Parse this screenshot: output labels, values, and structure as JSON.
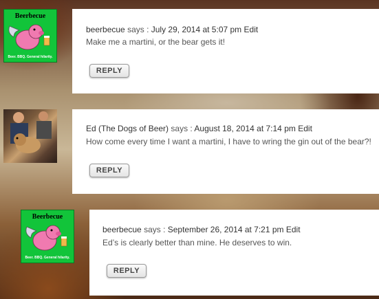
{
  "comments": [
    {
      "author": "beerbecue",
      "says": "says :",
      "date": "July 29, 2014 at 5:07 pm",
      "edit": "Edit",
      "text": "Make me a martini, or the bear gets it!",
      "reply": "REPLY",
      "avatar": {
        "type": "pig-logo",
        "title": "Beerbecue",
        "tagline": "Beer. BBQ. General hilarity."
      }
    },
    {
      "author": "Ed (The Dogs of Beer)",
      "says": "says :",
      "date": "August 18, 2014 at 7:14 pm",
      "edit": "Edit",
      "text": "How come every time I want a martini, I have to wring the gin out of the bear?!",
      "reply": "REPLY",
      "avatar": {
        "type": "photo"
      }
    },
    {
      "author": "beerbecue",
      "says": "says :",
      "date": "September 26, 2014 at 7:21 pm",
      "edit": "Edit",
      "text": "Ed’s is clearly better than mine. He deserves to win.",
      "reply": "REPLY",
      "avatar": {
        "type": "pig-logo",
        "title": "Beerbecue",
        "tagline": "Beer. BBQ. General hilarity."
      }
    }
  ]
}
